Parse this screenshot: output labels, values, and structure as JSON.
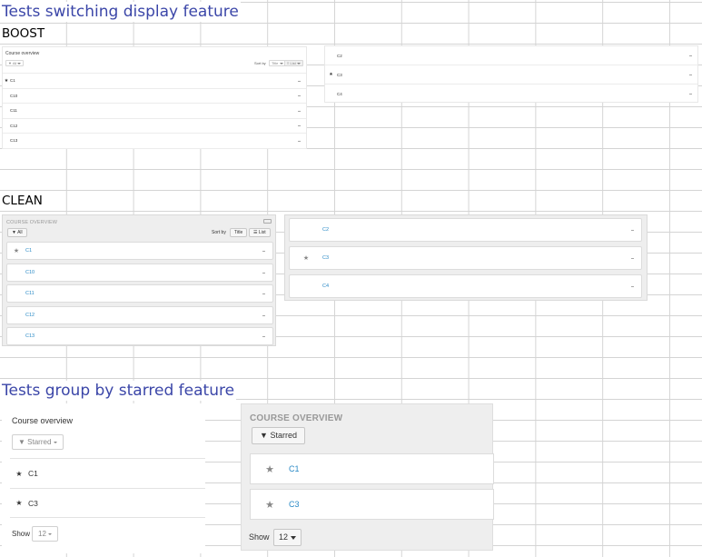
{
  "headings": {
    "switching": "Tests switching display feature",
    "boost": "BOOST",
    "clean": "CLEAN",
    "starred": "Tests group by starred feature"
  },
  "boost": {
    "title": "Course overview",
    "filter_label": "All",
    "sort_label": "Sort by",
    "sort_value": "Title",
    "view_value": "List",
    "list_left": [
      {
        "name": "C1",
        "starred": true
      },
      {
        "name": "C10",
        "starred": false
      },
      {
        "name": "C11",
        "starred": false
      },
      {
        "name": "C12",
        "starred": false
      },
      {
        "name": "C13",
        "starred": false
      }
    ],
    "list_right": [
      {
        "name": "C2",
        "starred": false
      },
      {
        "name": "C3",
        "starred": true
      },
      {
        "name": "C4",
        "starred": false
      }
    ],
    "dots": "..."
  },
  "clean": {
    "title": "COURSE OVERVIEW",
    "filter_label": "All",
    "sort_label": "Sort by",
    "sort_value": "Title",
    "view_value": "List",
    "list_left": [
      {
        "name": "C1",
        "starred": true
      },
      {
        "name": "C10",
        "starred": false
      },
      {
        "name": "C11",
        "starred": false
      },
      {
        "name": "C12",
        "starred": false
      },
      {
        "name": "C13",
        "starred": false
      }
    ],
    "list_right": [
      {
        "name": "C2",
        "starred": false
      },
      {
        "name": "C3",
        "starred": true
      },
      {
        "name": "C4",
        "starred": false
      }
    ],
    "dots": "..."
  },
  "starred_boost": {
    "title": "Course overview",
    "filter_label": "Starred",
    "items": [
      {
        "name": "C1"
      },
      {
        "name": "C3"
      }
    ],
    "show_label": "Show",
    "show_value": "12"
  },
  "starred_clean": {
    "title": "COURSE OVERVIEW",
    "filter_label": "Starred",
    "items": [
      {
        "name": "C1"
      },
      {
        "name": "C3"
      }
    ],
    "show_label": "Show",
    "show_value": "12"
  },
  "icons": {
    "star": "★",
    "filter": "filter-icon",
    "list": "list-icon"
  },
  "colors": {
    "heading_blue": "#3b46a8",
    "link_blue": "#2a8ac6",
    "panel_gray": "#eeeeee"
  }
}
